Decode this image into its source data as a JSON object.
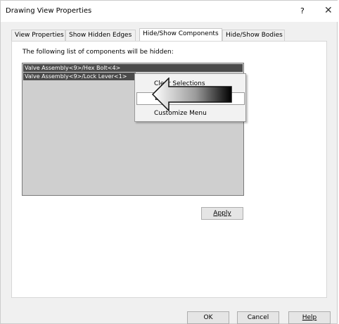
{
  "dialog": {
    "title": "Drawing View Properties",
    "help_glyph": "?",
    "close_glyph": "✕"
  },
  "tabs": [
    {
      "label": "View Properties"
    },
    {
      "label": "Show Hidden Edges"
    },
    {
      "label": "Hide/Show Components",
      "active": true
    },
    {
      "label": "Hide/Show Bodies"
    }
  ],
  "panel": {
    "intro": "The following list of components will be hidden:",
    "list": [
      "Valve Assembly<9>/Hex Bolt<4>",
      "Valve Assembly<9>/Lock Lever<1>"
    ],
    "apply_label": "Apply"
  },
  "context_menu": {
    "items": [
      "Clear Selections",
      "Delete",
      "Customize Menu"
    ]
  },
  "footer": {
    "ok_label": "OK",
    "cancel_label": "Cancel",
    "help_label": "Help"
  }
}
